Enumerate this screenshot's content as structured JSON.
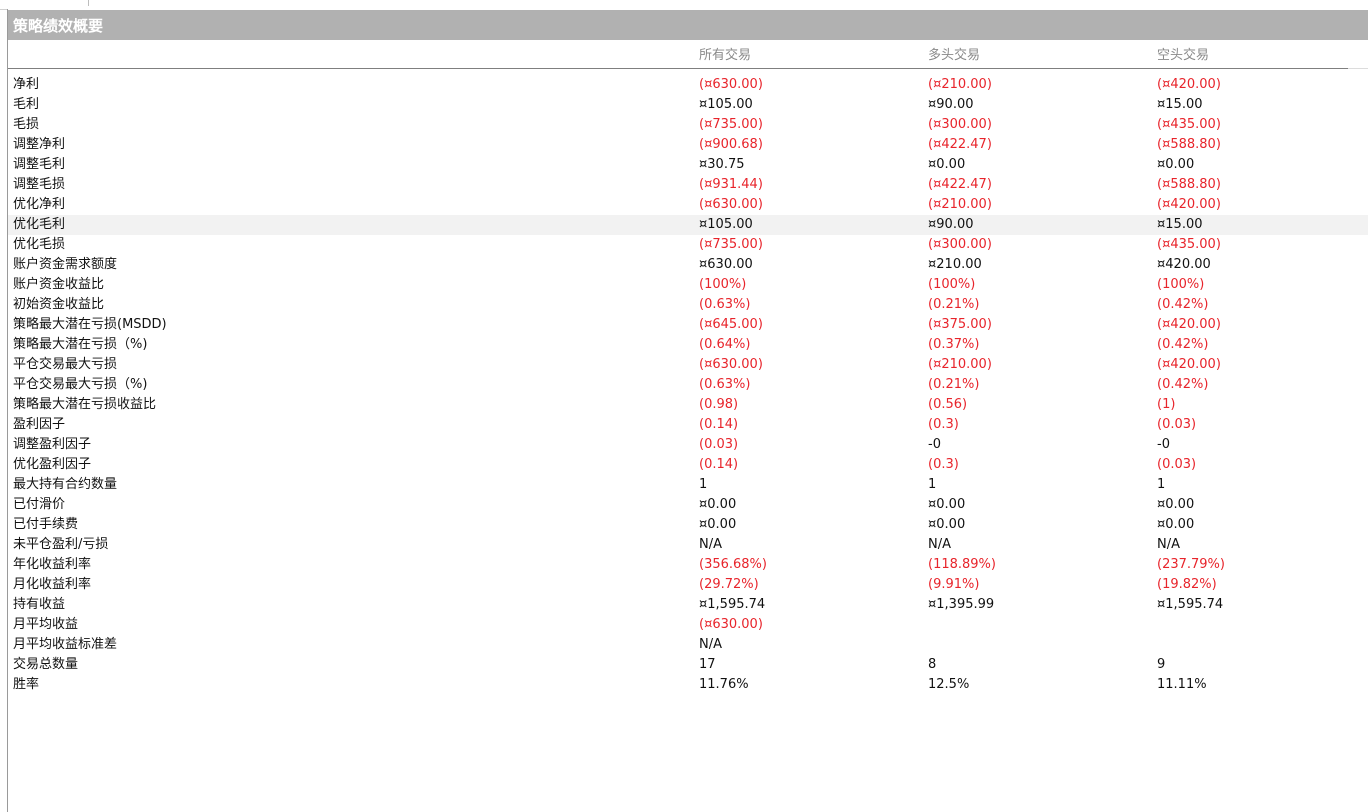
{
  "panel": {
    "title": "策略绩效概要",
    "columns": [
      "所有交易",
      "多头交易",
      "空头交易"
    ],
    "highlight_row": 7,
    "rows": [
      {
        "label": "净利",
        "values": [
          "(¤630.00)",
          "(¤210.00)",
          "(¤420.00)"
        ]
      },
      {
        "label": "毛利",
        "values": [
          "¤105.00",
          "¤90.00",
          "¤15.00"
        ]
      },
      {
        "label": "毛损",
        "values": [
          "(¤735.00)",
          "(¤300.00)",
          "(¤435.00)"
        ]
      },
      {
        "label": "调整净利",
        "values": [
          "(¤900.68)",
          "(¤422.47)",
          "(¤588.80)"
        ]
      },
      {
        "label": "调整毛利",
        "values": [
          "¤30.75",
          "¤0.00",
          "¤0.00"
        ]
      },
      {
        "label": "调整毛损",
        "values": [
          "(¤931.44)",
          "(¤422.47)",
          "(¤588.80)"
        ]
      },
      {
        "label": "优化净利",
        "values": [
          "(¤630.00)",
          "(¤210.00)",
          "(¤420.00)"
        ]
      },
      {
        "label": "优化毛利",
        "values": [
          "¤105.00",
          "¤90.00",
          "¤15.00"
        ]
      },
      {
        "label": "优化毛损",
        "values": [
          "(¤735.00)",
          "(¤300.00)",
          "(¤435.00)"
        ]
      },
      {
        "label": "账户资金需求额度",
        "values": [
          "¤630.00",
          "¤210.00",
          "¤420.00"
        ]
      },
      {
        "label": "账户资金收益比",
        "values": [
          "(100%)",
          "(100%)",
          "(100%)"
        ]
      },
      {
        "label": "初始资金收益比",
        "values": [
          "(0.63%)",
          "(0.21%)",
          "(0.42%)"
        ]
      },
      {
        "label": "策略最大潜在亏损(MSDD)",
        "values": [
          "(¤645.00)",
          "(¤375.00)",
          "(¤420.00)"
        ]
      },
      {
        "label": "策略最大潜在亏损（%)",
        "values": [
          "(0.64%)",
          "(0.37%)",
          "(0.42%)"
        ]
      },
      {
        "label": "平仓交易最大亏损",
        "values": [
          "(¤630.00)",
          "(¤210.00)",
          "(¤420.00)"
        ]
      },
      {
        "label": "平仓交易最大亏损（%)",
        "values": [
          "(0.63%)",
          "(0.21%)",
          "(0.42%)"
        ]
      },
      {
        "label": "策略最大潜在亏损收益比",
        "values": [
          "(0.98)",
          "(0.56)",
          "(1)"
        ]
      },
      {
        "label": "盈利因子",
        "values": [
          "(0.14)",
          "(0.3)",
          "(0.03)"
        ]
      },
      {
        "label": "调整盈利因子",
        "values": [
          "(0.03)",
          "-0",
          "-0"
        ]
      },
      {
        "label": "优化盈利因子",
        "values": [
          "(0.14)",
          "(0.3)",
          "(0.03)"
        ]
      },
      {
        "label": "最大持有合约数量",
        "values": [
          "1",
          "1",
          "1"
        ]
      },
      {
        "label": "已付滑价",
        "values": [
          "¤0.00",
          "¤0.00",
          "¤0.00"
        ]
      },
      {
        "label": "已付手续费",
        "values": [
          "¤0.00",
          "¤0.00",
          "¤0.00"
        ]
      },
      {
        "label": "未平仓盈利/亏损",
        "values": [
          "N/A",
          "N/A",
          "N/A"
        ]
      },
      {
        "label": "年化收益利率",
        "values": [
          "(356.68%)",
          "(118.89%)",
          "(237.79%)"
        ]
      },
      {
        "label": "月化收益利率",
        "values": [
          "(29.72%)",
          "(9.91%)",
          "(19.82%)"
        ]
      },
      {
        "label": "持有收益",
        "values": [
          "¤1,595.74",
          "¤1,395.99",
          "¤1,595.74"
        ]
      },
      {
        "label": "月平均收益",
        "values": [
          "(¤630.00)",
          "",
          ""
        ]
      },
      {
        "label": "月平均收益标准差",
        "values": [
          "N/A",
          "",
          ""
        ]
      },
      {
        "label": "交易总数量",
        "values": [
          "17",
          "8",
          "9"
        ]
      },
      {
        "label": "胜率",
        "values": [
          "11.76%",
          "12.5%",
          "11.11%"
        ]
      }
    ]
  }
}
